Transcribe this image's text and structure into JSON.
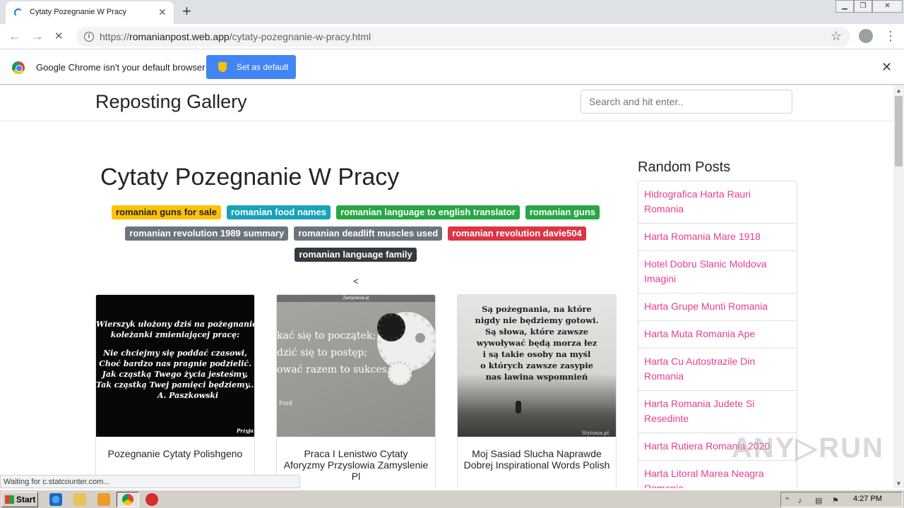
{
  "browser": {
    "tab_title": "Cytaty Pozegnanie W Pracy",
    "tab_close": "✕",
    "new_tab": "+",
    "url_scheme": "https://",
    "url_host": "romanianpost.web.app",
    "url_path": "/cytaty-pozegnanie-w-pracy.html",
    "back": "←",
    "forward": "→",
    "reload": "✕",
    "star": "☆",
    "menu": "⋮"
  },
  "infobar": {
    "message": "Google Chrome isn't your default browser",
    "button_label": "Set as default",
    "close": "✕"
  },
  "site": {
    "brand": "Reposting Gallery",
    "search_placeholder": "Search and hit enter.."
  },
  "post": {
    "title": "Cytaty Pozegnanie W Pracy",
    "tags": [
      {
        "label": "romanian guns for sale",
        "color": "#ffc107"
      },
      {
        "label": "romanian food names",
        "color": "#17a2b8"
      },
      {
        "label": "romanian language to english translator",
        "color": "#28a745"
      },
      {
        "label": "romanian guns",
        "color": "#28a745"
      },
      {
        "label": "romanian revolution 1989 summary",
        "color": "#6c757d"
      },
      {
        "label": "romanian deadlift muscles used",
        "color": "#6c757d"
      },
      {
        "label": "romanian revolution davie504",
        "color": "#dc3545"
      },
      {
        "label": "romanian language family",
        "color": "#343a40"
      }
    ],
    "pager_prev": "<"
  },
  "cards": [
    {
      "title": "Pozegnanie Cytaty Polishgeno",
      "image_lines": [
        "Wierszyk ułożony dziś na pożegnanie",
        "koleżanki zmieniającej pracę:",
        "Nie chciejmy się poddać czasowi,",
        "Choć bardzo nas pragnie podzielić.",
        "Jak cząstką Twego życia jesteśmy,",
        "Tak cząstką Twej pamięci będziemy...",
        "A. Paszkowski",
        "Przyja"
      ]
    },
    {
      "title": "Praca I Lenistwo Cytaty Aforyzmy Przyslowia Zamyslenie Pl",
      "image_header": "Zamyslenie.pl",
      "image_lines": [
        "kać się to początek;",
        "dzić się to postęp;",
        "ować razem to sukces.",
        "Ford"
      ]
    },
    {
      "title": "Moj Sasiad Slucha Naprawde Dobrej Inspirational Words Polish",
      "image_lines": [
        "Są pożegnania, na które",
        "nigdy nie będziemy gotowi.",
        "Są słowa, które zawsze",
        "wywoływać będą morza łez",
        "i są takie osoby na myśl",
        "o których zawsze zasypie",
        "nas lawina wspomnień",
        "Stylunia.pl"
      ]
    }
  ],
  "sidebar": {
    "title": "Random Posts",
    "items": [
      "Hidrografica Harta Rauri Romania",
      "Harta Romania Mare 1918",
      "Hotel Dobru Slanic Moldova Imagini",
      "Harta Grupe Munti Romania",
      "Harta Muta Romania Ape",
      "Harta Cu Autostrazile Din Romania",
      "Harta Romania Judete Si Resedinte",
      "Harta Rutiera Romania 2020",
      "Harta Litoral Marea Neagra Romania"
    ]
  },
  "status_text": "Waiting for c.statcounter.com...",
  "watermark": "ANY▷RUN",
  "taskbar": {
    "start_label": "Start",
    "clock": "4:27 PM"
  }
}
